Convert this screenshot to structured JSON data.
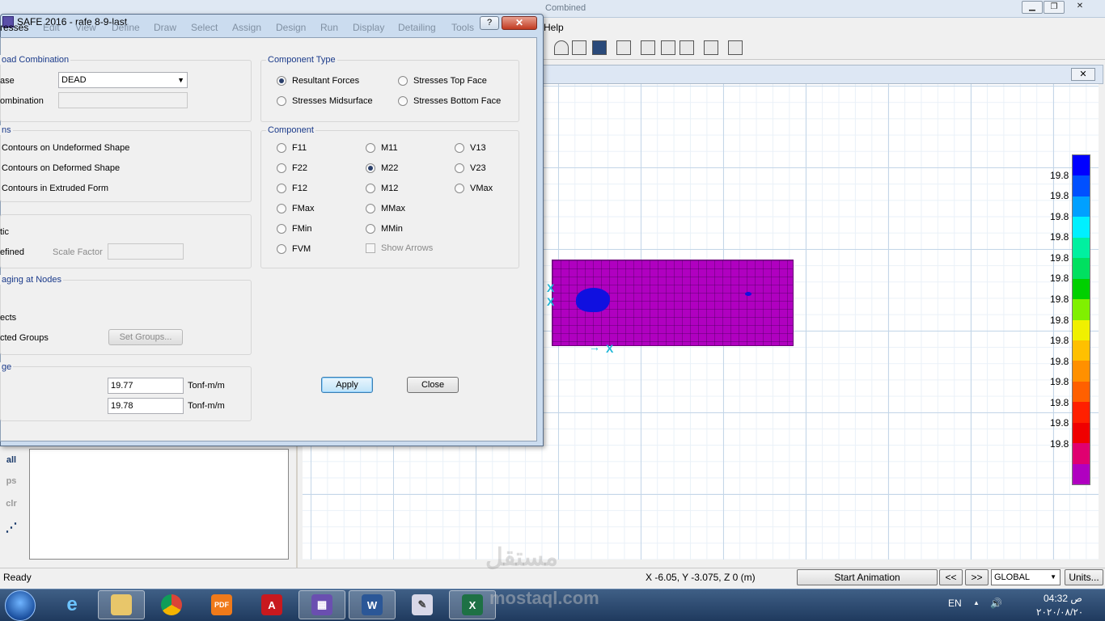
{
  "app": {
    "background_title": "Combined",
    "menu_help": "Help",
    "plot_close": "✕"
  },
  "dialog": {
    "title": "SAFE 2016  -  rafe 8-9-last",
    "help_btn": "?",
    "close_btn": "✕",
    "menu": [
      "resses",
      "Edit",
      "View",
      "Define",
      "Draw",
      "Select",
      "Assign",
      "Design",
      "Run",
      "Display",
      "Detailing",
      "Tools"
    ],
    "load_combination": {
      "title": "oad Combination",
      "case_label": "ase",
      "case_value": "DEAD",
      "combination_label": "ombination",
      "combination_value": ""
    },
    "component_type": {
      "title": "Component Type",
      "options": [
        "Resultant Forces",
        "Stresses Top Face",
        "Stresses Midsurface",
        "Stresses Bottom Face"
      ],
      "selected": "Resultant Forces"
    },
    "display_options": {
      "title": "ns",
      "options": [
        "Contours on Undeformed Shape",
        "Contours on Deformed Shape",
        "Contours in Extruded Form"
      ]
    },
    "scaling": {
      "auto_label": "tic",
      "user_label": "efined",
      "scale_factor_label": "Scale Factor",
      "scale_factor_value": ""
    },
    "averaging": {
      "title": "aging at Nodes",
      "objects_label": "ects",
      "groups_label": "cted Groups",
      "set_groups_btn": "Set Groups..."
    },
    "range": {
      "title": "ge",
      "min_value": "19.77",
      "min_unit": "Tonf-m/m",
      "max_value": "19.78",
      "max_unit": "Tonf-m/m"
    },
    "component": {
      "title": "Component",
      "col1": [
        "F11",
        "F22",
        "F12",
        "FMax",
        "FMin",
        "FVM"
      ],
      "col2": [
        "M11",
        "M22",
        "M12",
        "MMax",
        "MMin"
      ],
      "col3": [
        "V13",
        "V23",
        "VMax"
      ],
      "selected": "M22",
      "show_arrows": "Show Arrows"
    },
    "apply_btn": "Apply",
    "close_dialog_btn": "Close"
  },
  "legend": {
    "labels": [
      "19.8",
      "19.8",
      "19.8",
      "19.8",
      "19.8",
      "19.8",
      "19.8",
      "19.8",
      "19.8",
      "19.8",
      "19.8",
      "19.8",
      "19.8",
      "19.8"
    ],
    "colors": [
      "#0000ff",
      "#0050ff",
      "#00a0ff",
      "#00f0ff",
      "#00f0a0",
      "#00e060",
      "#00d000",
      "#80f000",
      "#f0f000",
      "#ffc000",
      "#ff9000",
      "#ff6000",
      "#ff2000",
      "#f00000",
      "#e00070",
      "#b000c0"
    ]
  },
  "left_side": {
    "buttons": [
      "all",
      "ps",
      "clr"
    ]
  },
  "status": {
    "ready": "Ready",
    "coords": "X -6.05, Y -3.075, Z 0  (m)",
    "start_animation": "Start Animation",
    "prev": "<<",
    "next": ">>",
    "coord_system": "GLOBAL",
    "units": "Units..."
  },
  "taskbar": {
    "lang": "EN",
    "time": "04:32 ص",
    "date": "٢٠٢٠/٠٨/٢٠"
  },
  "watermark": {
    "arabic": "مستقل",
    "latin": "mostaql.com"
  }
}
